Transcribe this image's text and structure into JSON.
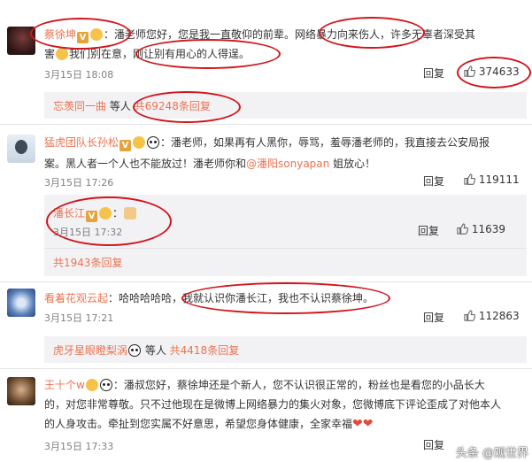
{
  "comments": [
    {
      "user": "蔡徐坤",
      "text_line1": "：潘老师您好，您是我一直敬仰的前辈。网络暴力向来伤人，许多无辜者深受其",
      "text_line2": "害",
      "text_line2b": "我们别在意，刚让别有用心的人得逞。",
      "time": "3月15日 18:08",
      "reply_label": "回复",
      "likes": "374633",
      "replies_summary_user": "忘羡同一曲",
      "replies_summary_mid": " 等人 ",
      "replies_summary_count": "共69248条回复"
    },
    {
      "user": "猛虎团队长孙松",
      "text_line1": "：潘老师，如果再有人黑你，辱骂，羞辱潘老师的，我直接去公安局报",
      "text_line2": "案。黑人者一个人也不能放过！潘老师你和",
      "mention": "@潘阳sonyapan",
      "text_line2b": " 姐放心！",
      "time": "3月15日 17:26",
      "reply_label": "回复",
      "likes": "119111",
      "reply": {
        "user": "潘长江",
        "time": "3月15日 17:32",
        "reply_label": "回复",
        "likes": "11639"
      },
      "more_replies": "共1943条回复"
    },
    {
      "user": "看着花观云起",
      "text": "：哈哈哈哈哈，我就认识你潘长江，我也不认识蔡徐坤。",
      "time": "3月15日 17:21",
      "reply_label": "回复",
      "likes": "112863",
      "replies_summary_user": "虎牙星眼瞪梨涡",
      "replies_summary_mid": " 等人 ",
      "replies_summary_count": "共4418条回复"
    },
    {
      "user": "王十个w",
      "text_line1": "：潘叔您好，蔡徐坤还是个新人，您不认识很正常的，粉丝也是看您的小品长大",
      "text_line2": "的，对您非常尊敬。只不过他现在是微博上网络暴力的集火对象，您微博底下评论歪成了对他本人",
      "text_line3": "的人身攻击。牵扯到您实属不好意思，希望您身体健康，全家幸福",
      "time": "3月15日 17:33",
      "reply_label": "回复"
    }
  ],
  "badge_letter": "V",
  "watermark": "头条 @观世界",
  "colors": {
    "name": "#eb7350",
    "annotation": "#d0161c",
    "sub_bg": "#f2f2f5"
  }
}
